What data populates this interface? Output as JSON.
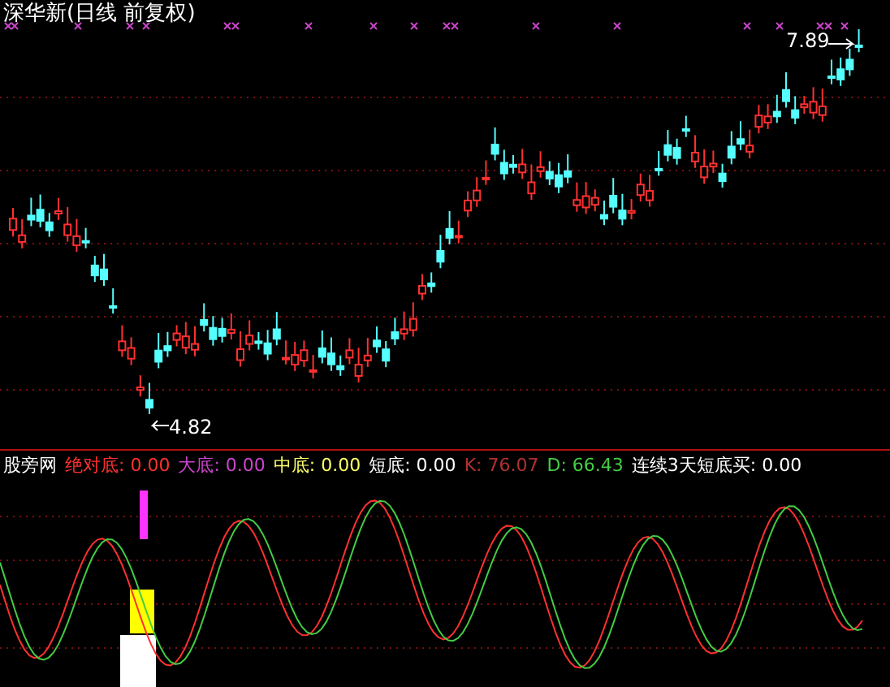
{
  "window": {
    "title": "深华新(日线 前复权)"
  },
  "price_labels": [
    {
      "kind": "high",
      "text": "7.89"
    },
    {
      "kind": "low",
      "text": "4.82"
    }
  ],
  "indicator": {
    "name": "股旁网",
    "legend": [
      {
        "label": "绝对底:",
        "value": "0.00",
        "color": "#ff3030"
      },
      {
        "label": "大底:",
        "value": "0.00",
        "color": "#cc44cc"
      },
      {
        "label": "中底:",
        "value": "0.00",
        "color": "#ffff66"
      },
      {
        "label": "短底:",
        "value": "0.00",
        "color": "#ffffff"
      },
      {
        "label": "K:",
        "value": "76.07",
        "color": "#b03030"
      },
      {
        "label": "D:",
        "value": "66.43",
        "color": "#44cc44"
      },
      {
        "label": "连续3天短底买:",
        "value": "0.00",
        "color": "#ffffff"
      }
    ]
  }
}
